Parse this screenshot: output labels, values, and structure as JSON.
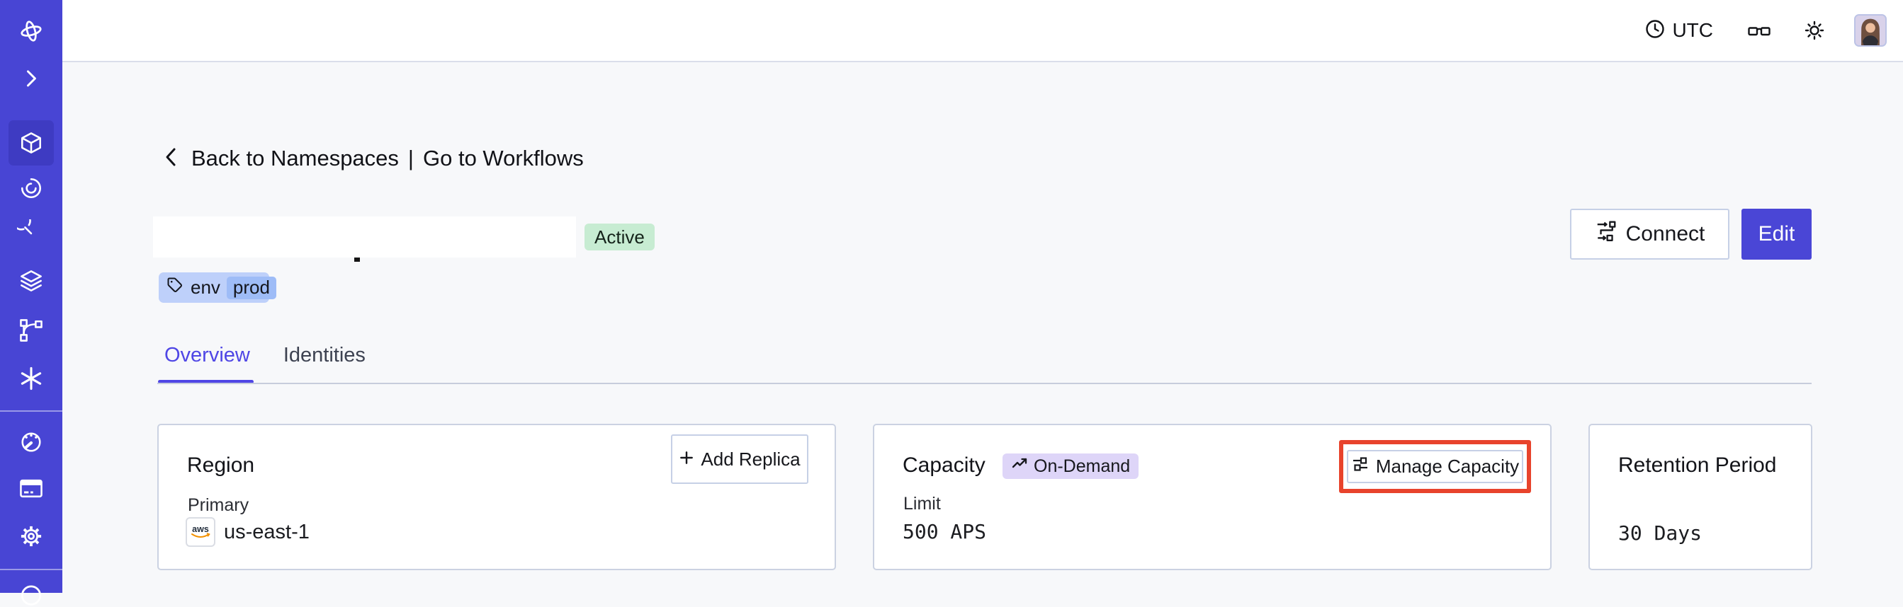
{
  "theme": {
    "sidebar_bg": "#4845d4",
    "sidebar_active_bg": "#3e3bc2",
    "accent_indigo": "#4a46d6",
    "tab_active_color": "#4f46e5",
    "content_bg": "#f7f8fa",
    "card_border": "#cbd2e2",
    "active_badge_bg": "#c7ecd2",
    "tag_bg": "#bed0fa",
    "tag_chip_bg": "#9ebcf7",
    "ondemand_badge_bg": "#ded5f8",
    "highlight_red": "#e8432c",
    "aws_orange": "#f29100"
  },
  "sidebar": {
    "icons": [
      "temporal-logo",
      "expand-chevron",
      "namespaces-cube",
      "workflows-spiral",
      "schedules-clock",
      "stack-layers",
      "deployments-branch",
      "nexus-asterisk",
      "usage-gauge",
      "billing-card",
      "settings-gear",
      "bottom-partial"
    ]
  },
  "topbar": {
    "timezone": "UTC",
    "icons": [
      "clock-icon",
      "glasses-icon",
      "sun-icon",
      "avatar"
    ]
  },
  "breadcrumb": {
    "back_label": "Back to Namespaces",
    "separator": "|",
    "forward_label": "Go to Workflows"
  },
  "namespace": {
    "status": "Active",
    "tag_key": "env",
    "tag_value": "prod"
  },
  "actions": {
    "connect_label": "Connect",
    "edit_label": "Edit"
  },
  "tabs": [
    {
      "label": "Overview",
      "active": true
    },
    {
      "label": "Identities",
      "active": false
    }
  ],
  "cards": {
    "region": {
      "title": "Region",
      "add_replica_label": "Add Replica",
      "primary_label": "Primary",
      "provider": "aws",
      "region_value": "us-east-1"
    },
    "capacity": {
      "title": "Capacity",
      "badge": "On-Demand",
      "manage_label": "Manage Capacity",
      "limit_label": "Limit",
      "limit_value": "500 APS"
    },
    "retention": {
      "title": "Retention Period",
      "value": "30 Days"
    }
  }
}
